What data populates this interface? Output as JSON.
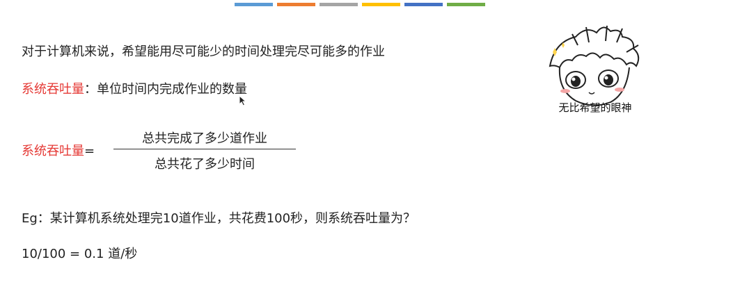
{
  "accent_colors": [
    "#5b9bd5",
    "#ed7d31",
    "#a5a5a5",
    "#ffc000",
    "#4472c4",
    "#70ad47"
  ],
  "highlight_color": "#e53935",
  "slide": {
    "intro": "对于计算机来说，希望能用尽可能少的时间处理完尽可能多的作业",
    "definition": {
      "term": "系统吞吐量",
      "text": "：单位时间内完成作业的数量"
    },
    "formula": {
      "term": "系统吞吐量",
      "equals": "=",
      "numerator": "总共完成了多少道作业",
      "denominator": "总共花了多少时间"
    },
    "example_question": "Eg：某计算机系统处理完10道作业，共花费100秒，则系统吞吐量为？",
    "example_answer": "10/100 = 0.1 道/秒"
  },
  "sticker": {
    "caption": "无比希望的眼神"
  }
}
